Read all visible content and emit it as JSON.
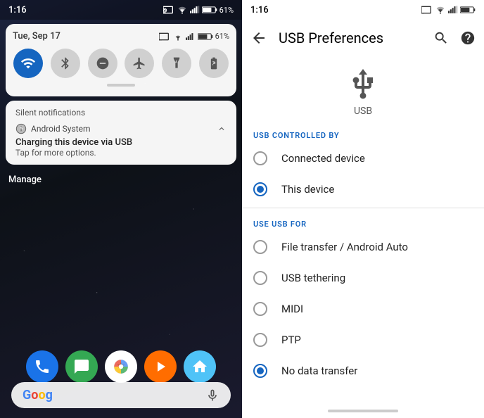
{
  "left": {
    "time": "1:16",
    "date": "Tue, Sep 17",
    "battery": "61%",
    "quick_toggles": [
      {
        "name": "wifi",
        "active": true,
        "label": "wifi-icon"
      },
      {
        "name": "bluetooth",
        "active": false,
        "label": "bluetooth-icon"
      },
      {
        "name": "dnd",
        "active": false,
        "label": "dnd-icon"
      },
      {
        "name": "airplane",
        "active": false,
        "label": "airplane-icon"
      },
      {
        "name": "flashlight",
        "active": false,
        "label": "flashlight-icon"
      },
      {
        "name": "battery-saver",
        "active": false,
        "label": "battery-saver-icon"
      }
    ],
    "silent_title": "Silent notifications",
    "notification_source": "Android System",
    "notification_title": "Charging this device via USB",
    "notification_body": "Tap for more options.",
    "manage_label": "Manage"
  },
  "right": {
    "time": "1:16",
    "title": "USB Preferences",
    "usb_label": "USB",
    "controlled_by_label": "USB CONTROLLED BY",
    "options_controlled": [
      {
        "id": "connected",
        "label": "Connected device",
        "selected": false
      },
      {
        "id": "this",
        "label": "This device",
        "selected": true
      }
    ],
    "use_for_label": "USE USB FOR",
    "options_use_for": [
      {
        "id": "file",
        "label": "File transfer / Android Auto",
        "selected": false
      },
      {
        "id": "tethering",
        "label": "USB tethering",
        "selected": false
      },
      {
        "id": "midi",
        "label": "MIDI",
        "selected": false
      },
      {
        "id": "ptp",
        "label": "PTP",
        "selected": false
      },
      {
        "id": "nodata",
        "label": "No data transfer",
        "selected": true
      }
    ]
  }
}
